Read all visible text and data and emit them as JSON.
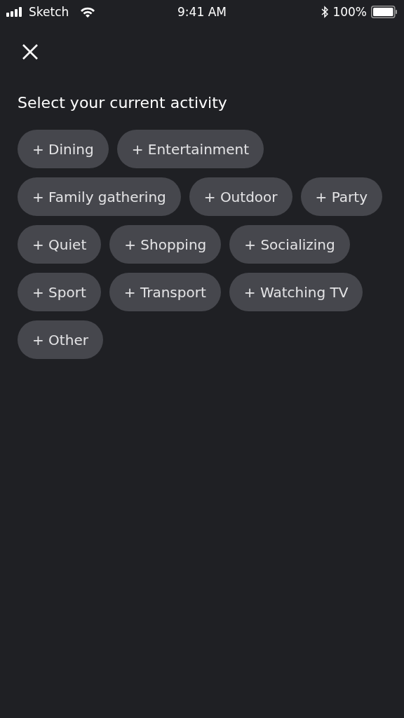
{
  "status_bar": {
    "carrier": "Sketch",
    "time": "9:41 AM",
    "battery": "100%"
  },
  "title": "Select your current activity",
  "chips": [
    {
      "label": "+ Dining"
    },
    {
      "label": "+ Entertainment"
    },
    {
      "label": "+ Family gathering"
    },
    {
      "label": "+ Outdoor"
    },
    {
      "label": "+ Party"
    },
    {
      "label": "+ Quiet"
    },
    {
      "label": "+ Shopping"
    },
    {
      "label": "+ Socializing"
    },
    {
      "label": "+ Sport"
    },
    {
      "label": "+ Transport"
    },
    {
      "label": "+ Watching TV"
    },
    {
      "label": "+ Other"
    }
  ]
}
